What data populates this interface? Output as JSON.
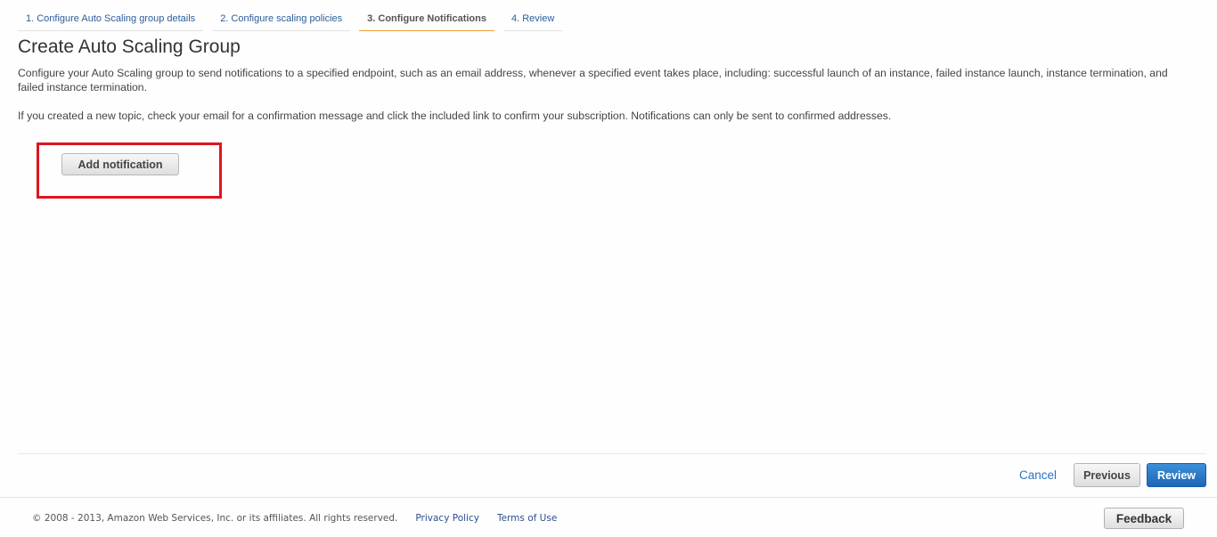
{
  "wizard": {
    "steps": [
      {
        "label": "1. Configure Auto Scaling group details"
      },
      {
        "label": "2. Configure scaling policies"
      },
      {
        "label": "3. Configure Notifications"
      },
      {
        "label": "4. Review"
      }
    ],
    "active_step": 2
  },
  "page": {
    "title": "Create Auto Scaling Group",
    "description": "Configure your Auto Scaling group to send notifications to a specified endpoint, such as an email address, whenever a specified event takes place, including: successful launch of an instance, failed instance launch, instance termination, and failed instance termination.",
    "note": "If you created a new topic, check your email for a confirmation message and click the included link to confirm your subscription. Notifications can only be sent to confirmed addresses.",
    "add_notification_label": "Add notification"
  },
  "actions": {
    "cancel_label": "Cancel",
    "previous_label": "Previous",
    "review_label": "Review"
  },
  "footer": {
    "copyright": "© 2008 - 2013, Amazon Web Services, Inc. or its affiliates. All rights reserved.",
    "privacy_label": "Privacy Policy",
    "terms_label": "Terms of Use",
    "feedback_label": "Feedback"
  },
  "colors": {
    "highlight": "#e0141e",
    "primary": "#1f66b8",
    "active_step_underline": "#f0a030",
    "link": "#2a74c4"
  }
}
